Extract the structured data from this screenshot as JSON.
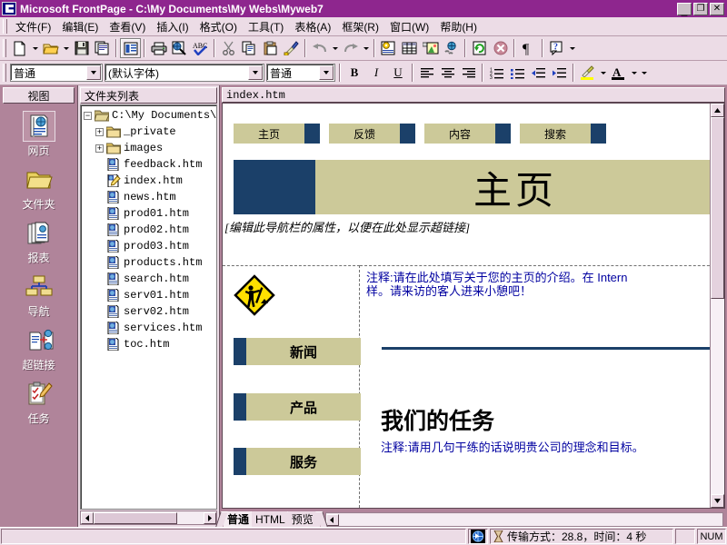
{
  "window": {
    "title": "Microsoft FrontPage - C:\\My Documents\\My Webs\\Myweb7",
    "minimize_label": "_",
    "restore_label": "❐",
    "close_label": "✕"
  },
  "menubar": {
    "items": [
      {
        "label": "文件(F)",
        "name": "menu-file"
      },
      {
        "label": "编辑(E)",
        "name": "menu-edit"
      },
      {
        "label": "查看(V)",
        "name": "menu-view"
      },
      {
        "label": "插入(I)",
        "name": "menu-insert"
      },
      {
        "label": "格式(O)",
        "name": "menu-format"
      },
      {
        "label": "工具(T)",
        "name": "menu-tools"
      },
      {
        "label": "表格(A)",
        "name": "menu-table"
      },
      {
        "label": "框架(R)",
        "name": "menu-frames"
      },
      {
        "label": "窗口(W)",
        "name": "menu-window"
      },
      {
        "label": "帮助(H)",
        "name": "menu-help"
      }
    ]
  },
  "standard_toolbar": {
    "icons": [
      "new-page-icon",
      "new-page-dropdown-icon",
      "open-folder-icon",
      "open-dropdown-icon",
      "save-icon",
      "publish-web-icon",
      "page-properties-icon",
      "print-icon",
      "preview-in-browser-icon",
      "spelling-icon",
      "cut-icon",
      "copy-icon",
      "paste-icon",
      "format-painter-icon",
      "undo-icon",
      "undo-dropdown-icon",
      "redo-icon",
      "redo-dropdown-icon",
      "web-component-icon",
      "insert-table-icon",
      "insert-picture-icon",
      "hyperlink-icon",
      "refresh-icon",
      "stop-icon",
      "show-all-icon",
      "help-icon",
      "toolbar-overflow-icon"
    ]
  },
  "format_toolbar": {
    "style_value": "普通",
    "font_value": "(默认字体)",
    "size_value": "普通",
    "bold_label": "B",
    "italic_label": "I",
    "underline_label": "U",
    "icons": [
      "align-left-icon",
      "align-center-icon",
      "align-right-icon",
      "numbered-list-icon",
      "bulleted-list-icon",
      "decrease-indent-icon",
      "increase-indent-icon",
      "highlight-color-icon",
      "font-color-icon",
      "toolbar-overflow-icon"
    ]
  },
  "views_bar": {
    "header": "视图",
    "items": [
      {
        "label": "网页",
        "icon": "page-view-icon",
        "selected": true
      },
      {
        "label": "文件夹",
        "icon": "folders-view-icon",
        "selected": false
      },
      {
        "label": "报表",
        "icon": "reports-view-icon",
        "selected": false
      },
      {
        "label": "导航",
        "icon": "navigation-view-icon",
        "selected": false
      },
      {
        "label": "超链接",
        "icon": "hyperlinks-view-icon",
        "selected": false
      },
      {
        "label": "任务",
        "icon": "tasks-view-icon",
        "selected": false
      }
    ]
  },
  "folder_list": {
    "header": "文件夹列表",
    "nodes": [
      {
        "label": "C:\\My Documents\\My",
        "type": "root-folder",
        "expander": "-",
        "indent": 0
      },
      {
        "label": "_private",
        "type": "folder",
        "expander": "+",
        "indent": 1
      },
      {
        "label": "images",
        "type": "folder",
        "expander": "+",
        "indent": 1
      },
      {
        "label": "feedback.htm",
        "type": "page",
        "expander": "",
        "indent": 1
      },
      {
        "label": "index.htm",
        "type": "page-open",
        "expander": "",
        "indent": 1
      },
      {
        "label": "news.htm",
        "type": "page",
        "expander": "",
        "indent": 1
      },
      {
        "label": "prod01.htm",
        "type": "page",
        "expander": "",
        "indent": 1
      },
      {
        "label": "prod02.htm",
        "type": "page",
        "expander": "",
        "indent": 1
      },
      {
        "label": "prod03.htm",
        "type": "page",
        "expander": "",
        "indent": 1
      },
      {
        "label": "products.htm",
        "type": "page",
        "expander": "",
        "indent": 1
      },
      {
        "label": "search.htm",
        "type": "page",
        "expander": "",
        "indent": 1
      },
      {
        "label": "serv01.htm",
        "type": "page",
        "expander": "",
        "indent": 1
      },
      {
        "label": "serv02.htm",
        "type": "page",
        "expander": "",
        "indent": 1
      },
      {
        "label": "services.htm",
        "type": "page",
        "expander": "",
        "indent": 1
      },
      {
        "label": "toc.htm",
        "type": "page",
        "expander": "",
        "indent": 1
      }
    ]
  },
  "editor": {
    "document_tab": "index.htm",
    "nav_buttons": [
      {
        "label": "主页"
      },
      {
        "label": "反馈"
      },
      {
        "label": "内容"
      },
      {
        "label": "搜索"
      }
    ],
    "banner_title": "主页",
    "nav_hint": "[编辑此导航栏的属性，以便在此处显示超链接]",
    "under_construction_icon": "under-construction-icon",
    "intro_comment_line1": "注释:请在此处填写关于您的主页的介绍。在 Intern",
    "intro_comment_line2": "样。请来访的客人进来小憩吧！",
    "side_buttons": [
      {
        "label": "新闻"
      },
      {
        "label": "产品"
      },
      {
        "label": "服务"
      }
    ],
    "mission_heading": "我们的任务",
    "mission_comment": "注释:请用几句干练的话说明贵公司的理念和目标。",
    "view_tabs": [
      {
        "label": "普通",
        "active": true
      },
      {
        "label": "HTML",
        "active": false
      },
      {
        "label": "预览",
        "active": false
      }
    ]
  },
  "statusbar": {
    "globe_icon": "globe-cursor-icon",
    "hourglass_icon": "hourglass-icon",
    "transfer_text": "传输方式：28.8，时间：4 秒",
    "num_label": "NUM"
  },
  "colors": {
    "titlebar": "#8e268e",
    "chrome": "#ecdce6",
    "desktop": "#b0849a",
    "theme_khaki": "#ccc999",
    "theme_navy": "#1b4069",
    "comment_blue": "#0000a0"
  }
}
